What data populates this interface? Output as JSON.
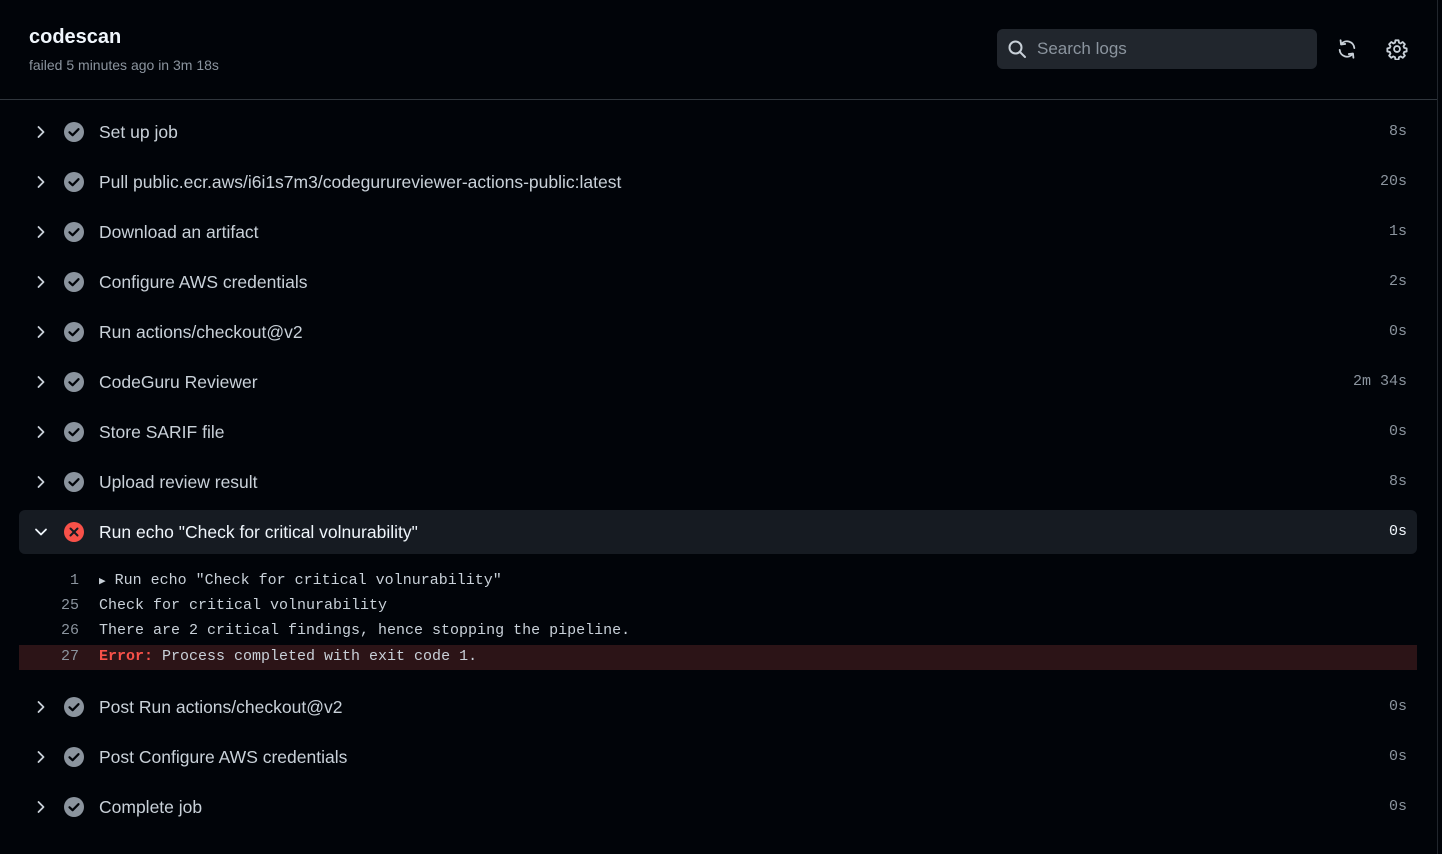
{
  "header": {
    "title": "codescan",
    "meta": "failed 5 minutes ago in 3m 18s",
    "search_placeholder": "Search logs",
    "refresh_icon": "sync-icon",
    "settings_icon": "gear-icon"
  },
  "colors": {
    "success": "#8b949e",
    "failure": "#f85149",
    "error_bg": "#2c1417",
    "expanded_bg": "#161b22"
  },
  "steps_before": [
    {
      "name": "Set up job",
      "time": "8s",
      "status": "success"
    },
    {
      "name": "Pull public.ecr.aws/i6i1s7m3/codegurureviewer-actions-public:latest",
      "time": "20s",
      "status": "success"
    },
    {
      "name": "Download an artifact",
      "time": "1s",
      "status": "success"
    },
    {
      "name": "Configure AWS credentials",
      "time": "2s",
      "status": "success"
    },
    {
      "name": "Run actions/checkout@v2",
      "time": "0s",
      "status": "success"
    },
    {
      "name": "CodeGuru Reviewer",
      "time": "2m 34s",
      "status": "success"
    },
    {
      "name": "Store SARIF file",
      "time": "0s",
      "status": "success"
    },
    {
      "name": "Upload review result",
      "time": "8s",
      "status": "success"
    }
  ],
  "failed_step": {
    "name": "Run echo \"Check for critical volnurability\"",
    "time": "0s",
    "status": "failure",
    "log": [
      {
        "line": "1",
        "text": "Run echo \"Check for critical volnurability\"",
        "collapsible": true
      },
      {
        "line": "25",
        "text": "Check for critical volnurability"
      },
      {
        "line": "26",
        "text": "There are 2 critical findings, hence stopping the pipeline."
      },
      {
        "line": "27",
        "label": "Error:",
        "text": " Process completed with exit code 1.",
        "error": true
      }
    ]
  },
  "steps_after": [
    {
      "name": "Post Run actions/checkout@v2",
      "time": "0s",
      "status": "success"
    },
    {
      "name": "Post Configure AWS credentials",
      "time": "0s",
      "status": "success"
    },
    {
      "name": "Complete job",
      "time": "0s",
      "status": "success"
    }
  ]
}
